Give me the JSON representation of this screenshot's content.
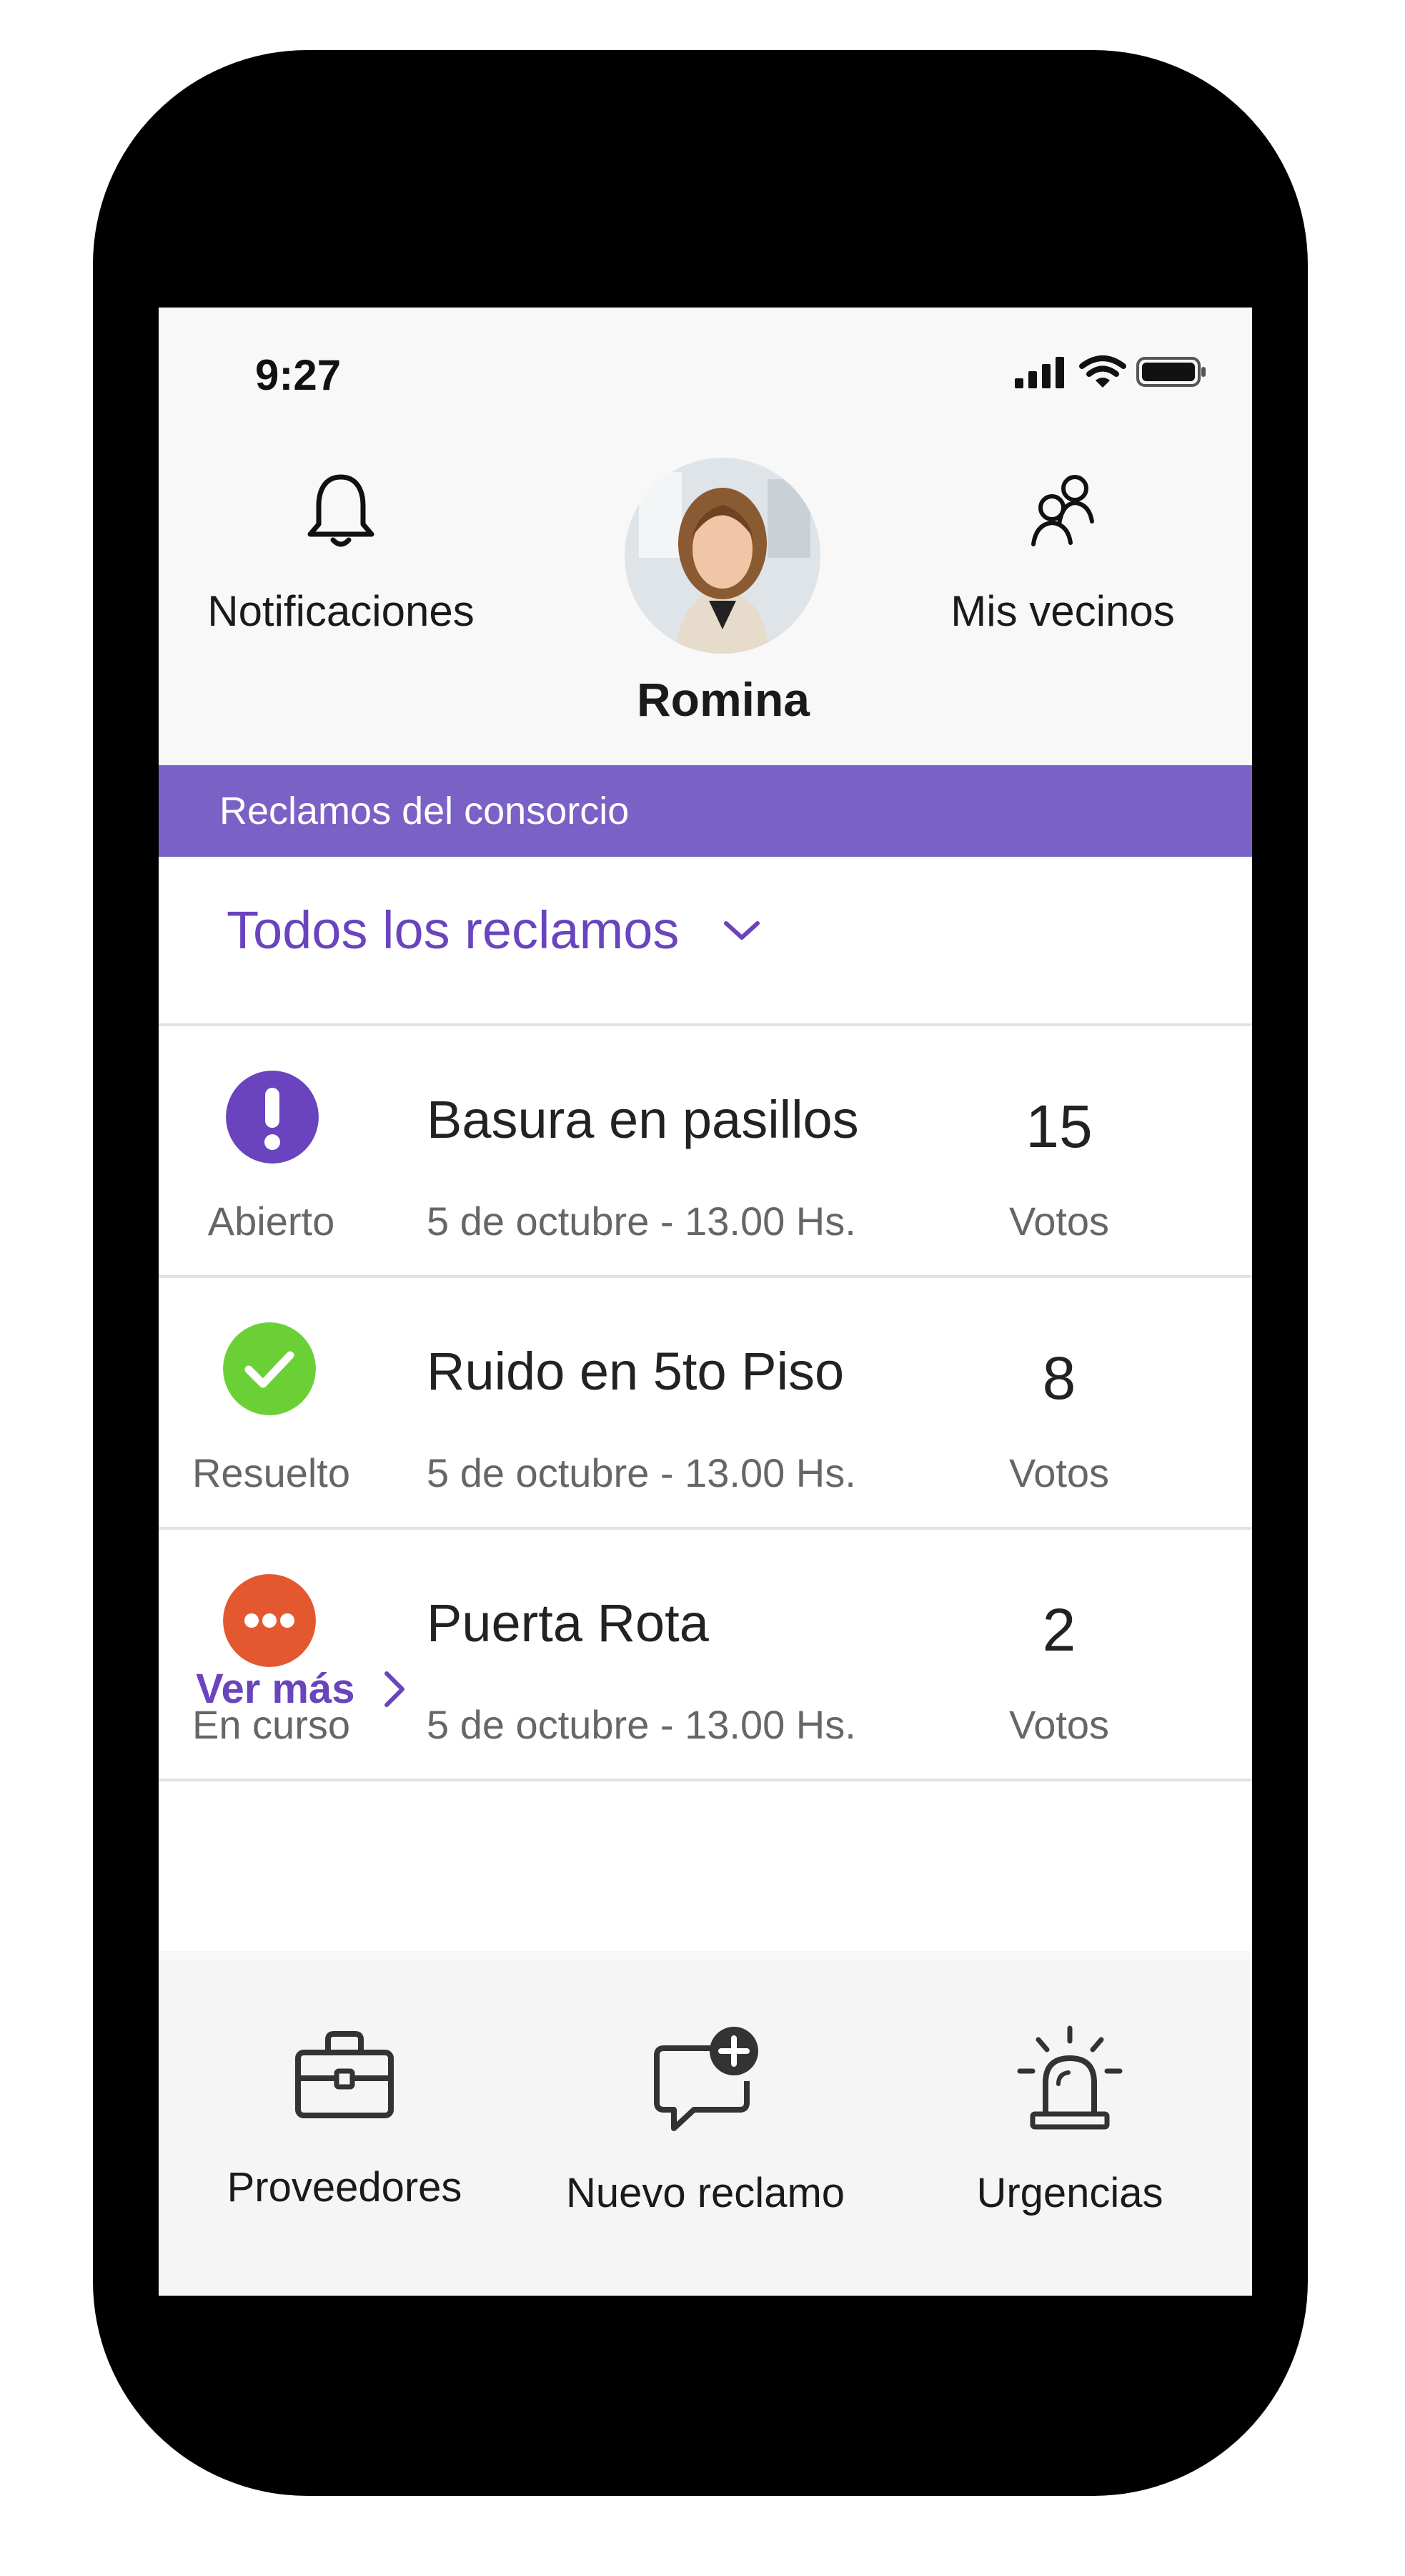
{
  "status_bar": {
    "time": "9:27"
  },
  "header": {
    "notifications_label": "Notificaciones",
    "user_name": "Romina",
    "neighbors_label": "Mis vecinos"
  },
  "banner": {
    "text": "Reclamos del consorcio"
  },
  "filter": {
    "selected": "Todos los reclamos"
  },
  "claims": [
    {
      "status": "Abierto",
      "status_icon": "exclamation-icon",
      "status_color": "#6a44be",
      "title": "Basura en pasillos",
      "date": "5 de octubre - 13.00 Hs.",
      "votes": "15",
      "votes_label": "Votos"
    },
    {
      "status": "Resuelto",
      "status_icon": "check-icon",
      "status_color": "#6bd036",
      "title": "Ruido en 5to Piso",
      "date": "5 de octubre - 13.00 Hs.",
      "votes": "8",
      "votes_label": "Votos"
    },
    {
      "status": "En curso",
      "status_icon": "ellipsis-icon",
      "status_color": "#e4582f",
      "title": "Puerta Rota",
      "date": "5 de octubre - 13.00 Hs.",
      "votes": "2",
      "votes_label": "Votos"
    }
  ],
  "see_more": "Ver más",
  "bottom_nav": {
    "providers": "Proveedores",
    "new_claim": "Nuevo reclamo",
    "urgent": "Urgencias"
  },
  "colors": {
    "accent": "#6a44be",
    "banner": "#7a61c5"
  }
}
